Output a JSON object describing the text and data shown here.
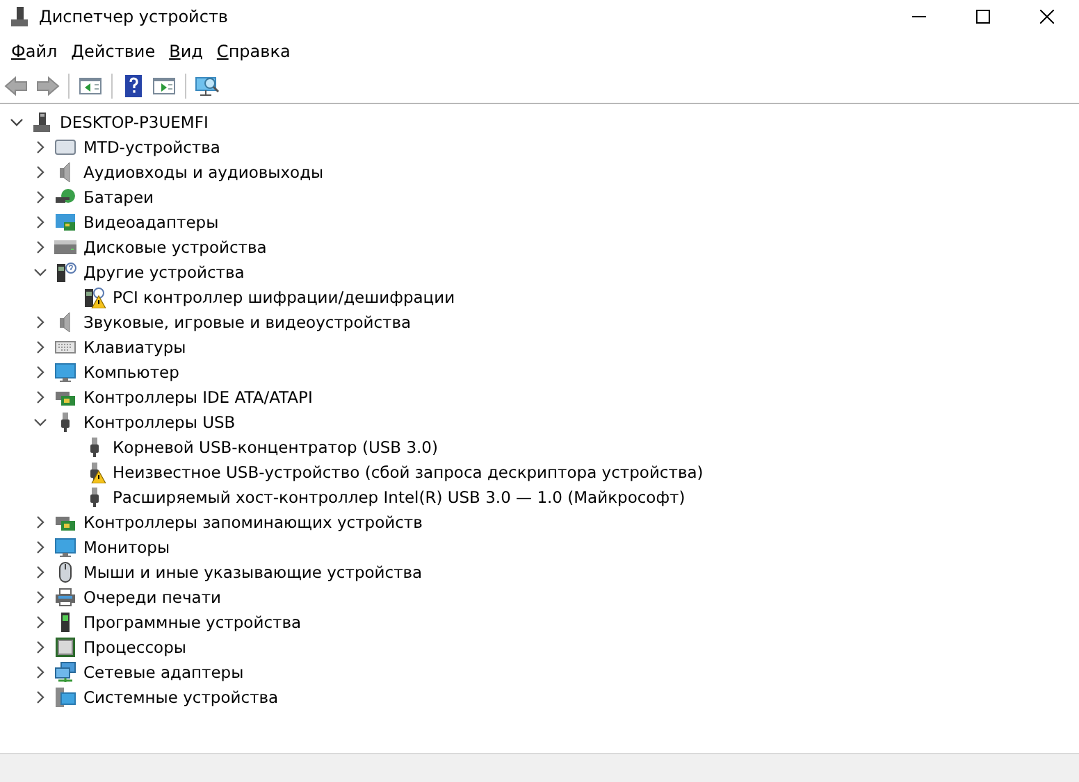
{
  "window": {
    "title": "Диспетчер устройств"
  },
  "menu": [
    {
      "label": "Файл"
    },
    {
      "label": "Действие"
    },
    {
      "label": "Вид"
    },
    {
      "label": "Справка"
    }
  ],
  "toolbar": [
    {
      "kind": "back",
      "disabled": true
    },
    {
      "kind": "forward",
      "disabled": true
    },
    {
      "kind": "sep"
    },
    {
      "kind": "properties",
      "disabled": false
    },
    {
      "kind": "sep"
    },
    {
      "kind": "help",
      "disabled": false
    },
    {
      "kind": "view",
      "disabled": false
    },
    {
      "kind": "sep"
    },
    {
      "kind": "scan",
      "disabled": false
    }
  ],
  "tree": {
    "label": "DESKTOP-P3UEMFI",
    "expanded": true,
    "children": [
      {
        "label": "MTD-устройства",
        "kind": "storage",
        "expanded": false
      },
      {
        "label": "Аудиовходы и аудиовыходы",
        "kind": "audio",
        "expanded": false
      },
      {
        "label": "Батареи",
        "kind": "battery",
        "expanded": false
      },
      {
        "label": "Видеоадаптеры",
        "kind": "display",
        "expanded": false
      },
      {
        "label": "Дисковые устройства",
        "kind": "disk",
        "expanded": false
      },
      {
        "label": "Другие устройства",
        "kind": "unknown",
        "expanded": true,
        "children": [
          {
            "label": "PCI контроллер шифрации/дешифрации",
            "kind": "unknown",
            "warning": true
          }
        ]
      },
      {
        "label": "Звуковые, игровые и видеоустройства",
        "kind": "audio",
        "expanded": false
      },
      {
        "label": "Клавиатуры",
        "kind": "keyboard",
        "expanded": false
      },
      {
        "label": "Компьютер",
        "kind": "monitor",
        "expanded": false
      },
      {
        "label": "Контроллеры IDE ATA/ATAPI",
        "kind": "card",
        "expanded": false
      },
      {
        "label": "Контроллеры USB",
        "kind": "usb",
        "expanded": true,
        "children": [
          {
            "label": "Корневой USB-концентратор (USB 3.0)",
            "kind": "usb",
            "warning": false
          },
          {
            "label": "Неизвестное USB-устройство (сбой запроса дескриптора устройства)",
            "kind": "usb",
            "warning": true
          },
          {
            "label": "Расширяемый хост-контроллер Intel(R) USB 3.0 — 1.0 (Майкрософт)",
            "kind": "usb",
            "warning": false
          }
        ]
      },
      {
        "label": "Контроллеры запоминающих устройств",
        "kind": "card",
        "expanded": false
      },
      {
        "label": "Мониторы",
        "kind": "monitor",
        "expanded": false
      },
      {
        "label": "Мыши и иные указывающие устройства",
        "kind": "mouse",
        "expanded": false
      },
      {
        "label": "Очереди печати",
        "kind": "printer",
        "expanded": false
      },
      {
        "label": "Программные устройства",
        "kind": "software",
        "expanded": false
      },
      {
        "label": "Процессоры",
        "kind": "cpu",
        "expanded": false
      },
      {
        "label": "Сетевые адаптеры",
        "kind": "network",
        "expanded": false
      },
      {
        "label": "Системные устройства",
        "kind": "system",
        "expanded": false
      }
    ]
  }
}
